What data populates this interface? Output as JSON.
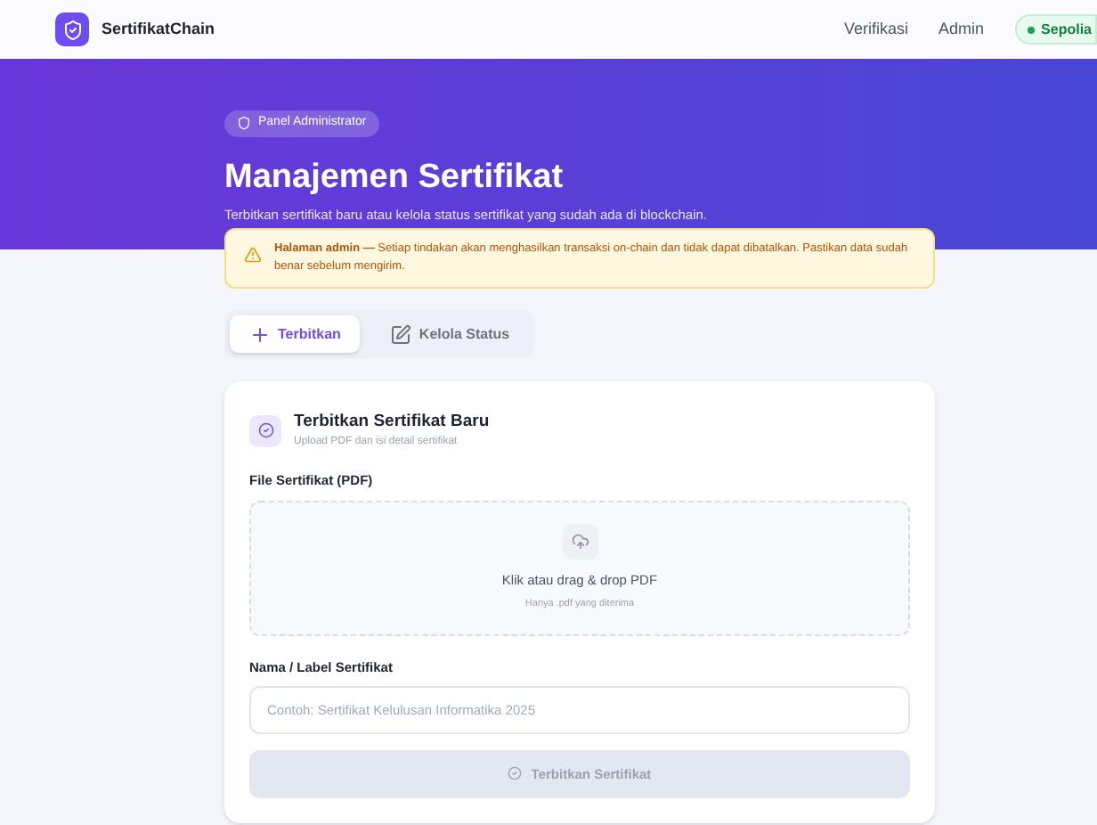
{
  "nav": {
    "brand": "SertifikatChain",
    "links": [
      "Verifikasi",
      "Admin"
    ],
    "network": "Sepolia"
  },
  "hero": {
    "badge": "Panel Administrator",
    "title": "Manajemen Sertifikat",
    "subtitle": "Terbitkan sertifikat baru atau kelola status sertifikat yang sudah ada di blockchain."
  },
  "warning": {
    "lead": "Halaman admin —",
    "text": "Setiap tindakan akan menghasilkan transaksi on-chain dan tidak dapat dibatalkan. Pastikan data sudah benar sebelum mengirim."
  },
  "tabs": [
    {
      "label": "Terbitkan",
      "kind": "plus",
      "selected": true
    },
    {
      "label": "Kelola Status",
      "kind": "edit",
      "selected": false
    }
  ],
  "card": {
    "title": "Terbitkan Sertifikat Baru",
    "subtitle": "Upload PDF dan isi detail sertifikat",
    "file_label": "File Sertifikat (PDF)",
    "drop_title": "Klik atau drag & drop PDF",
    "drop_hint": "Hanya .pdf yang diterima",
    "name_label": "Nama / Label Sertifikat",
    "name_placeholder": "Contoh: Sertifikat Kelulusan Informatika 2025",
    "submit": "Terbitkan Sertifikat",
    "submit_disabled": true
  }
}
